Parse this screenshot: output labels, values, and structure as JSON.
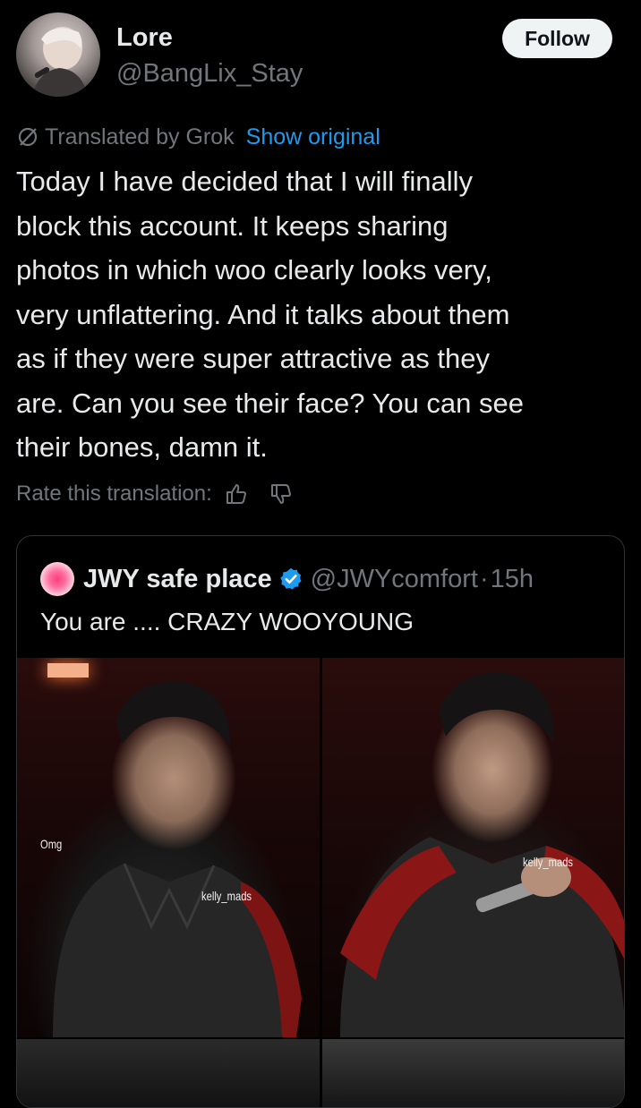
{
  "author": {
    "display_name": "Lore",
    "handle": "@BangLix_Stay",
    "avatar_icon": "user-avatar"
  },
  "follow_button": {
    "label": "Follow"
  },
  "translation": {
    "translated_by": "Translated by Grok",
    "show_original": "Show original",
    "icon": "grok-translate-icon"
  },
  "tweet": {
    "text": "Today I have decided that I will finally\nblock this account. It keeps sharing\nphotos in which woo clearly looks very,\nvery unflattering. And it talks about them\nas if they were super attractive as they\nare. Can you see their face? You can see\ntheir bones, damn it."
  },
  "rate_translation": {
    "label": "Rate this translation:",
    "thumbs_up_icon": "thumbs-up-icon",
    "thumbs_down_icon": "thumbs-down-icon"
  },
  "quoted_tweet": {
    "display_name": "JWY safe place",
    "verified": true,
    "handle": "@JWYcomfort",
    "separator": "·",
    "time": "15h",
    "text": "You are .... CRAZY WOOYOUNG",
    "media": {
      "left_overlay_text_1": "Omg",
      "left_overlay_text_2": "kelly_mads",
      "right_overlay_text": "kelly_mads"
    }
  },
  "colors": {
    "background": "#000000",
    "text_primary": "#e7e9ea",
    "text_secondary": "#71767b",
    "link": "#1d9bf0",
    "follow_bg": "#eff3f4",
    "verified": "#1d9bf0"
  }
}
